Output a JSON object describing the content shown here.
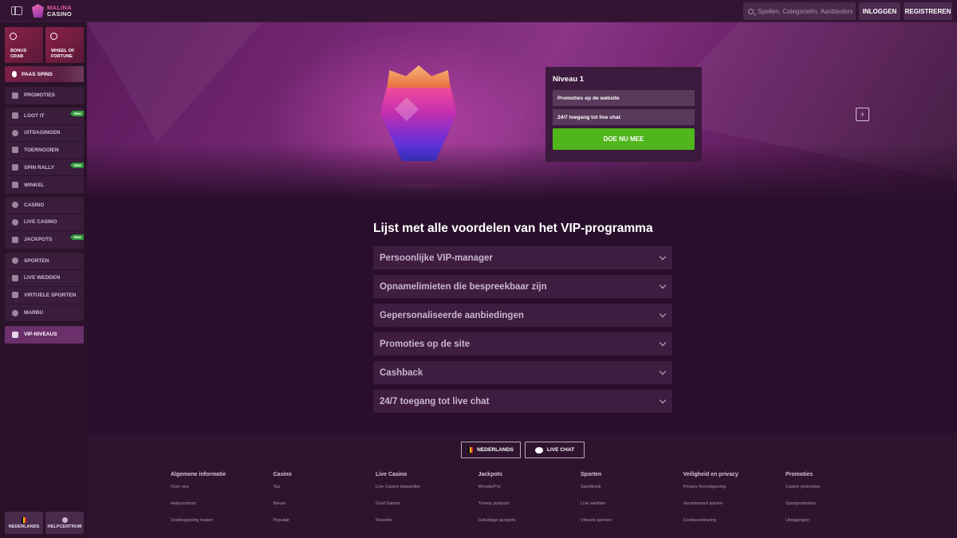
{
  "header": {
    "logo_line1": "MALINA",
    "logo_line2": "CASINO",
    "search_placeholder": "Spellen, Categorieën, Aanbieders",
    "login_label": "INLOGGEN",
    "register_label": "REGISTREREN"
  },
  "sidebar": {
    "tiles": [
      {
        "label": "BONUS CRAB",
        "icon": "crab-icon"
      },
      {
        "label": "WHEEL OF FORTUNE",
        "icon": "wheel-icon"
      }
    ],
    "paas_spins": "PAAS SPINS",
    "groups": [
      [
        {
          "label": "PROMOTIES",
          "icon": "gift-icon",
          "new": false
        }
      ],
      [
        {
          "label": "LOOT IT",
          "icon": "chest-icon",
          "new": true
        },
        {
          "label": "UITDAGINGEN",
          "icon": "challenge-icon",
          "new": false
        },
        {
          "label": "TOERNOOIEN",
          "icon": "trophy-icon",
          "new": false
        },
        {
          "label": "SPIN RALLY",
          "icon": "rally-icon",
          "new": true
        },
        {
          "label": "WINKEL",
          "icon": "shop-icon",
          "new": false
        }
      ],
      [
        {
          "label": "CASINO",
          "icon": "dice-icon",
          "new": false
        },
        {
          "label": "LIVE CASINO",
          "icon": "chip-icon",
          "new": false
        },
        {
          "label": "JACKPOTS",
          "icon": "jackpot-icon",
          "new": true
        }
      ],
      [
        {
          "label": "SPORTEN",
          "icon": "football-icon",
          "new": false
        },
        {
          "label": "LIVE WEDDEN",
          "icon": "live-icon",
          "new": false
        },
        {
          "label": "VIRTUELE SPORTEN",
          "icon": "virtual-icon",
          "new": false
        },
        {
          "label": "MARBU",
          "icon": "marbu-icon",
          "new": false
        }
      ],
      [
        {
          "label": "VIP-NIVEAUS",
          "icon": "diamond-icon",
          "new": false
        }
      ]
    ],
    "new_badge": "New",
    "bottom": {
      "language": "NEDERLANDS",
      "help": "HELPCENTRUM"
    }
  },
  "hero": {
    "level_title": "Niveau 1",
    "rows": [
      "Promoties op de website",
      "24/7 toegang tot live chat"
    ],
    "cta": "DOE NU MEE",
    "next_symbol": "›"
  },
  "vip": {
    "title": "Lijst met alle voordelen van het VIP-programma",
    "items": [
      "Persoonlijke VIP-manager",
      "Opnamelimieten die bespreekbaar zijn",
      "Gepersonaliseerde aanbiedingen",
      "Promoties op de site",
      "Cashback",
      "24/7 toegang tot live chat"
    ]
  },
  "footer": {
    "language_button": "NEDERLANDS",
    "chat_button": "LIVE CHAT",
    "columns": [
      {
        "title": "Algemene informatie",
        "links": [
          "Over ons",
          "Helpcentrum",
          "Snelkoppeling maken"
        ]
      },
      {
        "title": "Casino",
        "links": [
          "Top",
          "Nieuw",
          "Populair"
        ]
      },
      {
        "title": "Live Casino",
        "links": [
          "Live Casino topspellen",
          "Gold Saloon",
          "Roulette"
        ]
      },
      {
        "title": "Jackpots",
        "links": [
          "WonderPot",
          "Trendy jackpots",
          "Gelukkige jackpots"
        ]
      },
      {
        "title": "Sporten",
        "links": [
          "Sportbook",
          "Live wedden",
          "Virtuele sporten"
        ]
      },
      {
        "title": "Veiligheid en privacy",
        "links": [
          "Privacy Kennisgeving",
          "Verantwoord spelen",
          "Cookieverklaring"
        ]
      },
      {
        "title": "Promoties",
        "links": [
          "Casino promoties",
          "Sportpromoties",
          "Uitdagingen"
        ]
      }
    ]
  },
  "colors": {
    "accent_green": "#4fb61c",
    "new_badge_green": "#2e9b3a",
    "background": "#2a0f2c"
  }
}
